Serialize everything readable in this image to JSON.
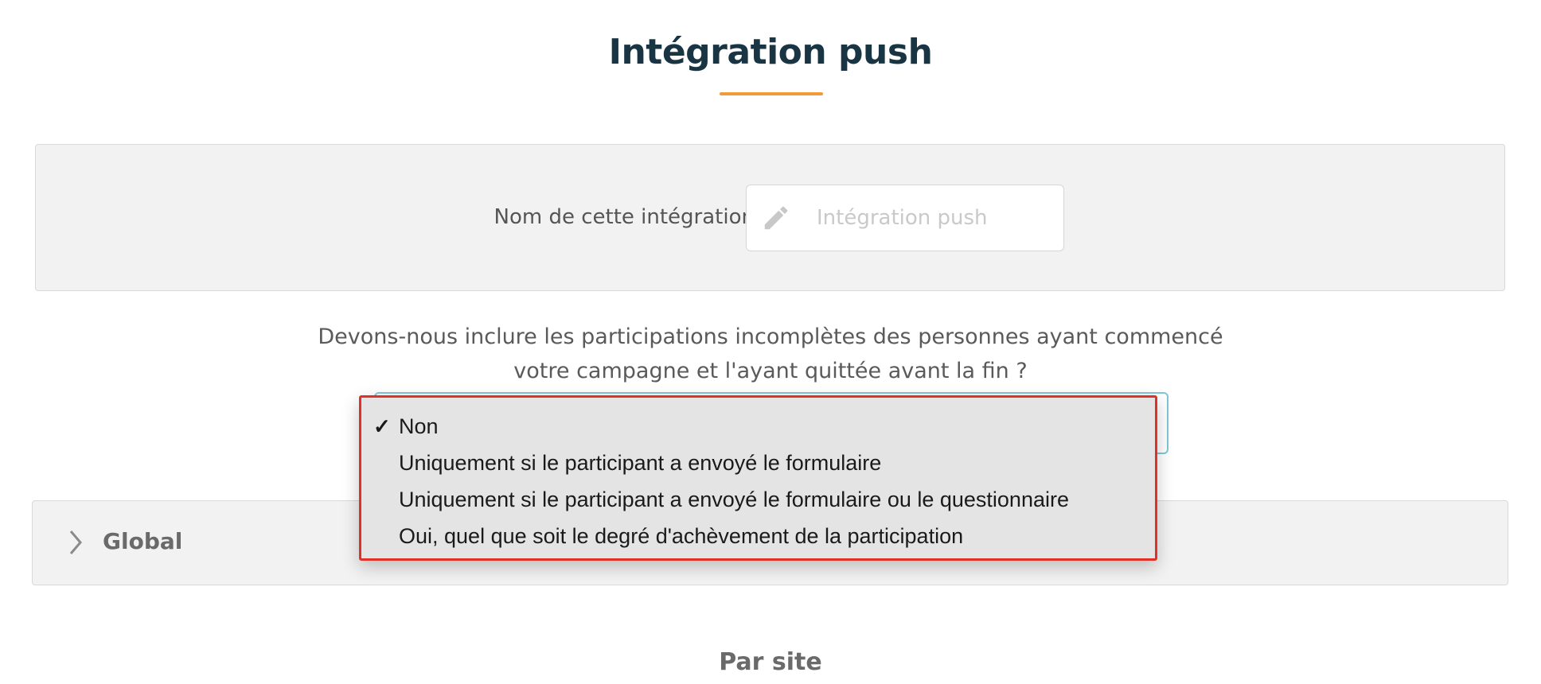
{
  "page": {
    "title": "Intégration push"
  },
  "name_section": {
    "label": "Nom de cette intégration :",
    "input_placeholder": "Intégration push",
    "input_value": ""
  },
  "question": {
    "line1": "Devons-nous inclure les participations incomplètes des personnes ayant commencé",
    "line2": "votre campagne et l'ayant quittée avant la fin ?"
  },
  "dropdown": {
    "selected": "Non",
    "options": [
      "Non",
      "Uniquement si le participant a envoyé le formulaire",
      "Uniquement si le participant a envoyé le formulaire ou le questionnaire",
      "Oui, quel que soit le degré d'achèvement de la participation"
    ],
    "check_glyph": "✓"
  },
  "global_section": {
    "title": "Global"
  },
  "by_site": {
    "title": "Par site"
  },
  "colors": {
    "title": "#193544",
    "accent_underline": "#f09a3a",
    "highlight_border": "#e0302a",
    "select_border": "#7fc7d6"
  }
}
